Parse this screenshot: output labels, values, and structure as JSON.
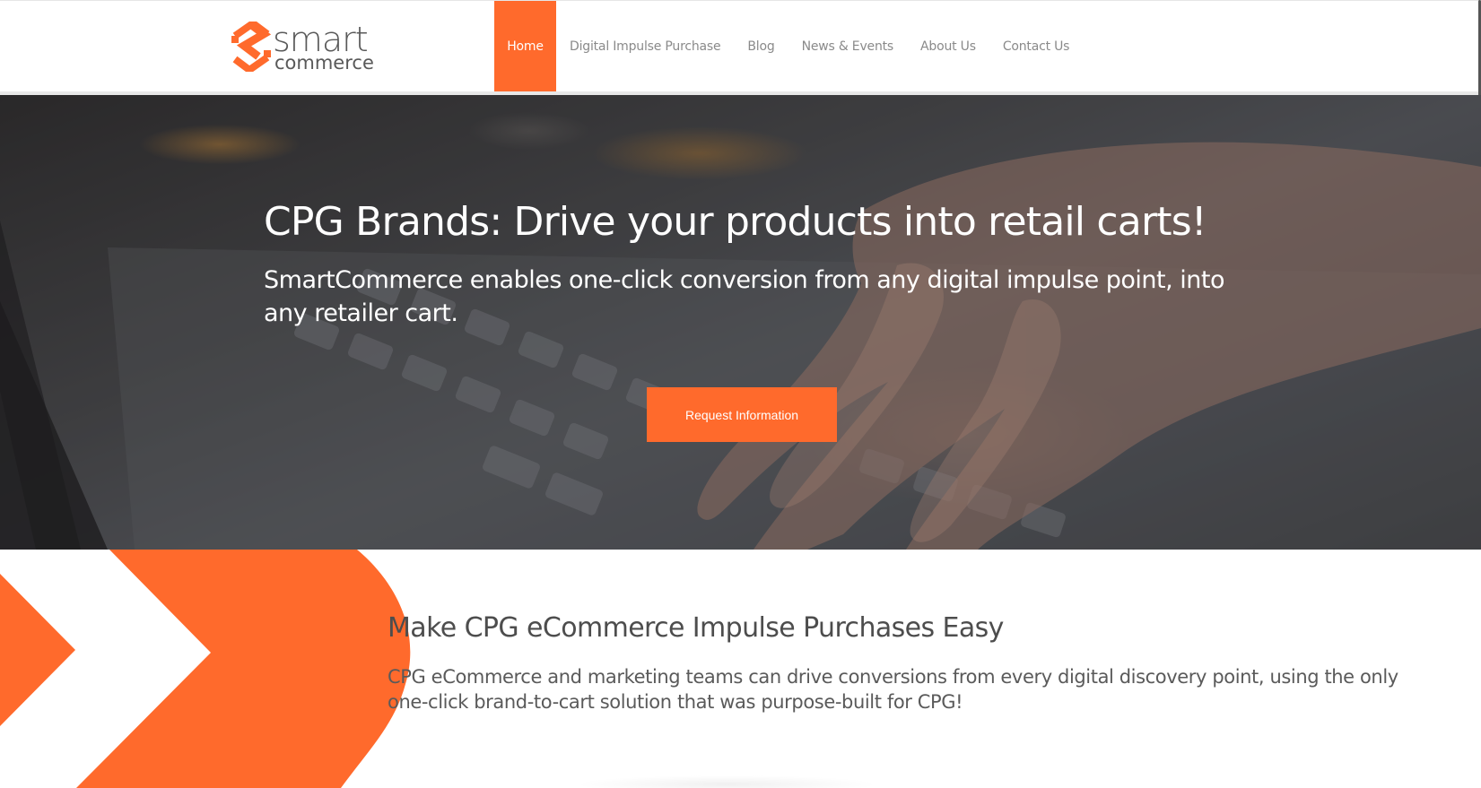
{
  "brand": {
    "word_top": "smart",
    "word_bottom": "commerce",
    "accent_color": "#ff6a2c"
  },
  "nav": {
    "items": [
      {
        "label": "Home",
        "active": true
      },
      {
        "label": "Digital Impulse Purchase",
        "active": false
      },
      {
        "label": "Blog",
        "active": false
      },
      {
        "label": "News & Events",
        "active": false
      },
      {
        "label": "About Us",
        "active": false
      },
      {
        "label": "Contact Us",
        "active": false
      }
    ]
  },
  "hero": {
    "title": "CPG Brands: Drive your products into retail carts!",
    "subtitle": "SmartCommerce enables one-click conversion from any digital impulse point, into any retailer cart.",
    "button_label": "Request Information",
    "background": "laptop-keyboard-hand-photo"
  },
  "section": {
    "title": "Make CPG eCommerce Impulse Purchases Easy",
    "body": "CPG eCommerce and marketing teams can drive conversions from every digital discovery point, using the only one-click brand-to-cart solution that was purpose-built for CPG!",
    "decoration": "orange-chevron-shapes"
  }
}
